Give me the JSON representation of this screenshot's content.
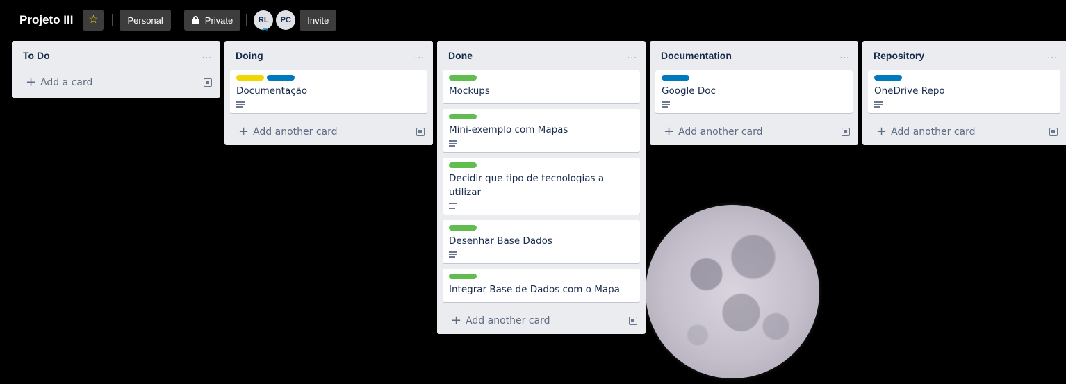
{
  "header": {
    "board_title": "Projeto III",
    "personal_label": "Personal",
    "private_label": "Private",
    "invite_label": "Invite",
    "members": [
      "RL",
      "PC"
    ]
  },
  "lists": [
    {
      "title": "To Do",
      "menu": "...",
      "add_label": "Add a card",
      "cards": []
    },
    {
      "title": "Doing",
      "menu": "...",
      "add_label": "Add another card",
      "cards": [
        {
          "title": "Documentação",
          "labels": [
            "#f2d600",
            "#0079bf"
          ],
          "has_description": true
        }
      ]
    },
    {
      "title": "Done",
      "menu": "...",
      "add_label": "Add another card",
      "cards": [
        {
          "title": "Mockups",
          "labels": [
            "#61bd4f"
          ],
          "has_description": false
        },
        {
          "title": "Mini-exemplo com Mapas",
          "labels": [
            "#61bd4f"
          ],
          "has_description": true
        },
        {
          "title": "Decidir que tipo de tecnologias a utilizar",
          "labels": [
            "#61bd4f"
          ],
          "has_description": true
        },
        {
          "title": "Desenhar Base Dados",
          "labels": [
            "#61bd4f"
          ],
          "has_description": true
        },
        {
          "title": "Integrar Base de Dados com o Mapa",
          "labels": [
            "#61bd4f"
          ],
          "has_description": false
        }
      ]
    },
    {
      "title": "Documentation",
      "menu": "...",
      "add_label": "Add another card",
      "cards": [
        {
          "title": "Google Doc",
          "labels": [
            "#0079bf"
          ],
          "has_description": true
        }
      ]
    },
    {
      "title": "Repository",
      "menu": "...",
      "add_label": "Add another card",
      "cards": [
        {
          "title": "OneDrive Repo",
          "labels": [
            "#0079bf"
          ],
          "has_description": true
        }
      ]
    }
  ],
  "colors": {
    "green_label": "#61bd4f",
    "yellow_label": "#f2d600",
    "blue_label": "#0079bf",
    "board_background": "#000000"
  }
}
